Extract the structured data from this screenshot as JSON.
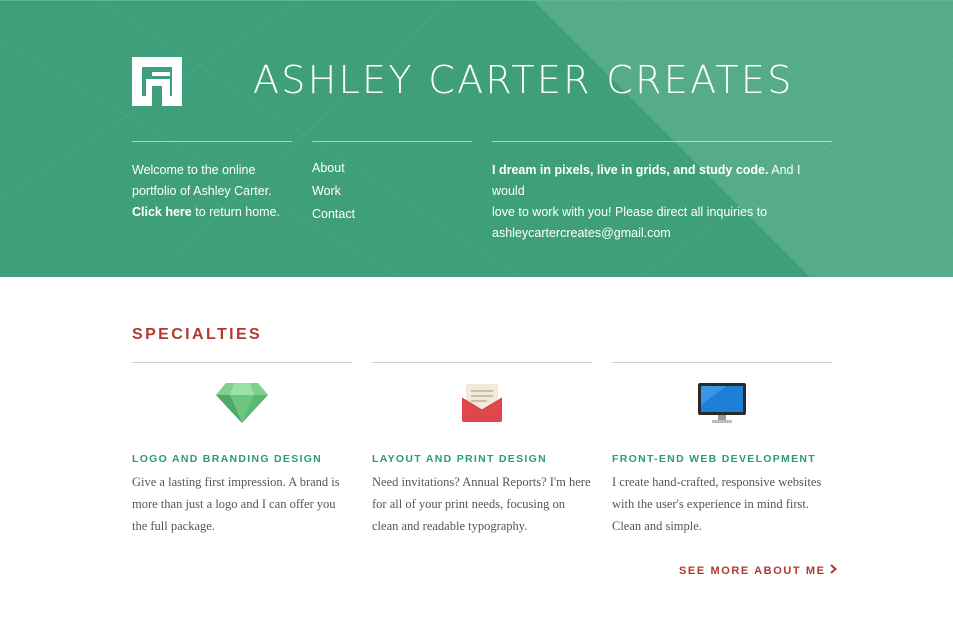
{
  "header": {
    "site_title": "ASHLEY CARTER CREATES",
    "logo_alt": "Ashley Carter logo",
    "welcome": {
      "line1": "Welcome to the online",
      "line2": "portfolio of Ashley Carter.",
      "click_here": "Click here",
      "line3_rest": " to return home."
    },
    "nav": [
      {
        "label": "About"
      },
      {
        "label": "Work"
      },
      {
        "label": "Contact"
      }
    ],
    "contact": {
      "bold": "I dream in pixels, live in grids, and study code.",
      "line1_rest": " And I would",
      "line2": "love to work with you! Please direct all inquiries to",
      "email": "ashleycartercreates@gmail.com"
    }
  },
  "specialties": {
    "title": "SPECIALTIES",
    "items": [
      {
        "icon": "gem-icon",
        "heading": "LOGO AND BRANDING DESIGN",
        "text": "Give a lasting first impression. A brand is more than just a logo and I can offer you the full package."
      },
      {
        "icon": "envelope-icon",
        "heading": "LAYOUT AND PRINT DESIGN",
        "text": "Need invitations? Annual Reports? I'm here for all of your print needs, focusing on clean and readable typography."
      },
      {
        "icon": "monitor-icon",
        "heading": "FRONT-END WEB DEVELOPMENT",
        "text": "I create hand-crafted, responsive websites with the user's experience in mind first. Clean and simple."
      }
    ],
    "see_more": "SEE MORE ABOUT ME"
  },
  "colors": {
    "header_green": "#3f9f7a",
    "accent_red": "#b03a32",
    "heading_green": "#2d9c6e"
  }
}
